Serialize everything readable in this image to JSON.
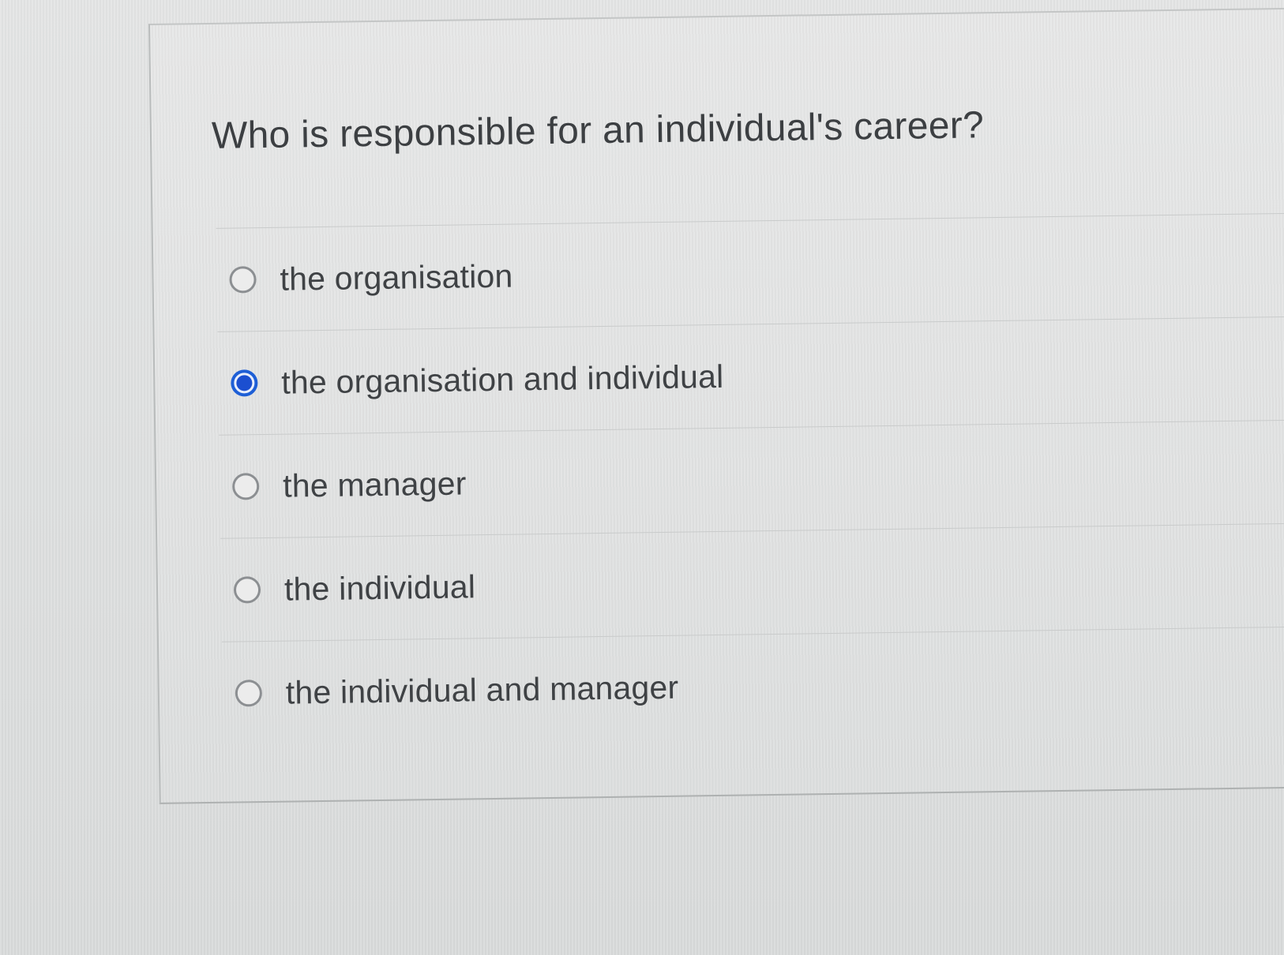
{
  "question": {
    "text": "Who is responsible for an individual's career?"
  },
  "options": [
    {
      "label": "the organisation",
      "selected": false
    },
    {
      "label": "the organisation and individual",
      "selected": true
    },
    {
      "label": "the manager",
      "selected": false
    },
    {
      "label": "the individual",
      "selected": false
    },
    {
      "label": "the individual and manager",
      "selected": false
    }
  ],
  "colors": {
    "accent": "#1b4fd0",
    "text": "#3f4245",
    "background": "#dedfdf"
  }
}
